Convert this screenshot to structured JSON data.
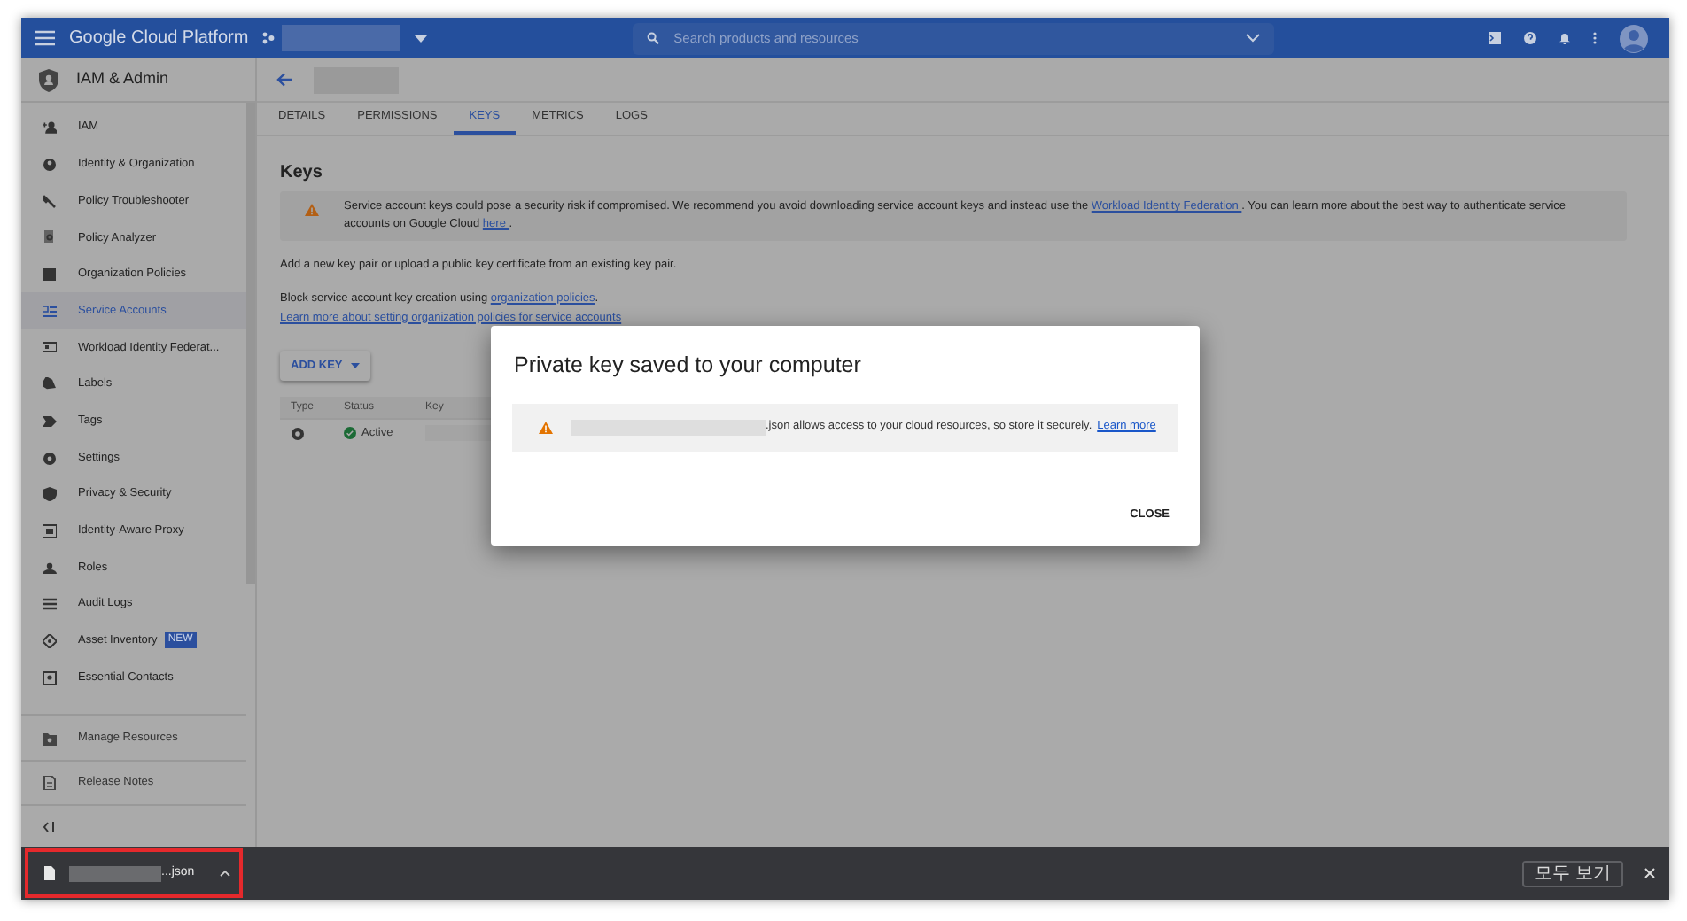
{
  "top_bar": {
    "product": "Google Cloud Platform",
    "search": {
      "placeholder": "Search products and resources"
    }
  },
  "sidebar": {
    "title": "IAM & Admin",
    "items": [
      {
        "label": "IAM",
        "selected": false
      },
      {
        "label": "Identity & Organization",
        "selected": false
      },
      {
        "label": "Policy Troubleshooter",
        "selected": false
      },
      {
        "label": "Policy Analyzer",
        "selected": false
      },
      {
        "label": "Organization Policies",
        "selected": false
      },
      {
        "label": "Service Accounts",
        "selected": true
      },
      {
        "label": "Workload Identity Federat...",
        "selected": false
      },
      {
        "label": "Labels",
        "selected": false
      },
      {
        "label": "Tags",
        "selected": false
      },
      {
        "label": "Settings",
        "selected": false
      },
      {
        "label": "Privacy & Security",
        "selected": false
      },
      {
        "label": "Identity-Aware Proxy",
        "selected": false
      },
      {
        "label": "Roles",
        "selected": false
      },
      {
        "label": "Audit Logs",
        "selected": false
      },
      {
        "label": "Asset Inventory",
        "selected": false,
        "badge": "NEW"
      },
      {
        "label": "Essential Contacts",
        "selected": false
      }
    ],
    "footer_items": [
      {
        "label": "Manage Resources"
      },
      {
        "label": "Release Notes"
      }
    ]
  },
  "tabs": [
    {
      "label": "DETAILS",
      "selected": false
    },
    {
      "label": "PERMISSIONS",
      "selected": false
    },
    {
      "label": "KEYS",
      "selected": true
    },
    {
      "label": "METRICS",
      "selected": false
    },
    {
      "label": "LOGS",
      "selected": false
    }
  ],
  "section_title": "Keys",
  "warning": {
    "text": "Service account keys could pose a security risk if compromised. We recommend you avoid downloading service account keys and instead use the ",
    "link": "Workload Identity Federation ",
    "middle": ". You can learn more about the best way to authenticate service accounts on Google Cloud ",
    "link_2": "here ",
    "after": "."
  },
  "description": "Add a new key pair or upload a public key certificate from an existing key pair.",
  "block_note": {
    "text": "Block service account key creation using ",
    "link": "organization policies",
    "after": "."
  },
  "learn_more_link": "Learn more about setting organization policies for service accounts",
  "add_key_button": "ADD KEY",
  "table": {
    "columns": [
      "Type",
      "Status",
      "Key"
    ],
    "rows": [
      {
        "status": "Active"
      }
    ]
  },
  "dialog": {
    "title": "Private key saved to your computer",
    "message": ".json allows access to your cloud resources, so store it securely.",
    "link": "Learn more",
    "button": "CLOSE"
  },
  "download_bar": {
    "file_suffix": "...json",
    "show_all": "모두 보기"
  }
}
